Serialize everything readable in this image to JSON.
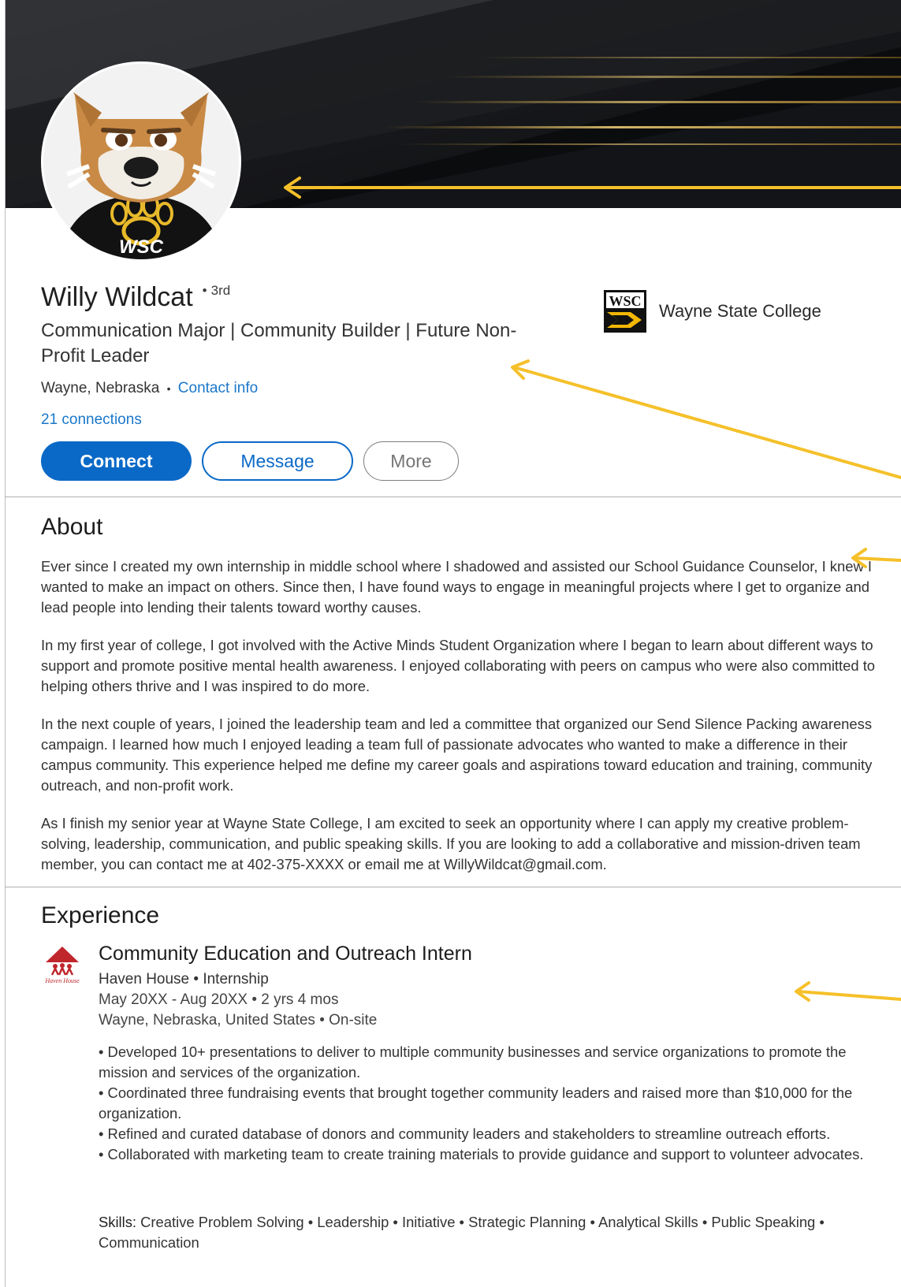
{
  "profile": {
    "name": "Willy Wildcat",
    "degree": "3rd",
    "headline": "Communication Major | Community Builder | Future Non-Profit Leader",
    "location": "Wayne, Nebraska",
    "contact_info": "Contact info",
    "connections": "21 connections",
    "buttons": {
      "connect": "Connect",
      "message": "Message",
      "more": "More"
    },
    "school": {
      "name": "Wayne State College",
      "logo_text": "WSC"
    },
    "avatar_shirt_text": "WSC"
  },
  "about": {
    "title": "About",
    "paragraphs": [
      "Ever since I created my own internship in middle school where I shadowed and assisted our School Guidance Counselor, I knew I wanted to make an impact on others. Since then, I have found ways to engage in meaningful projects where I get to organize and lead people into lending their talents toward worthy causes.",
      "In my first year of college, I got involved with the Active Minds Student Organization where I began to learn about different ways to support and promote positive mental health awareness. I enjoyed collaborating with peers on campus who were also committed to helping others thrive and I was inspired to do more.",
      "In the next couple of years, I joined the leadership team and led a committee that organized our Send Silence Packing awareness campaign. I learned how much I enjoyed leading a team full of passionate advocates who wanted to make a difference in their campus community. This experience helped me define my career goals and aspirations toward education and training, community outreach, and non-profit work.",
      "As I finish my senior year at Wayne State College, I am excited to seek an opportunity where I can apply my creative problem-solving, leadership, communication, and public speaking skills. If you are looking to add a collaborative and mission-driven team member, you can contact me at 402-375-XXXX or email me at WillyWildcat@gmail.com."
    ]
  },
  "experience": {
    "title": "Experience",
    "items": [
      {
        "role": "Community Education and Outreach Intern",
        "company_line": "Haven House • Internship",
        "dates": "May 20XX - Aug 20XX • 2 yrs 4 mos",
        "place": "Wayne, Nebraska, United States • On-site",
        "logo_text": "Haven House",
        "bullets": [
          "• Developed 10+ presentations to deliver to multiple community businesses and service organizations to promote the mission and services of the organization.",
          "• Coordinated three fundraising events that brought together community leaders and raised more than $10,000 for the organization.",
          "• Refined and curated database of donors and community leaders and stakeholders to streamline outreach efforts.",
          "• Collaborated with marketing team to create training materials to provide guidance and support to volunteer advocates."
        ],
        "skills_label": "Skills:",
        "skills": "Creative Problem Solving • Leadership • Initiative • Strategic Planning • Analytical Skills • Public Speaking • Communication"
      }
    ]
  },
  "colors": {
    "accent": "#0a69c7",
    "link": "#1a77c9",
    "arrow": "#f5c02a",
    "cover_dark": "#15171a",
    "gold": "#d6a73a",
    "haven_red": "#c0272d"
  },
  "icons": {
    "avatar": "wildcat-mascot",
    "school_logo": "wsc-logo-icon",
    "company_logo": "haven-house-logo-icon",
    "annotation": "arrow-left-icon"
  }
}
